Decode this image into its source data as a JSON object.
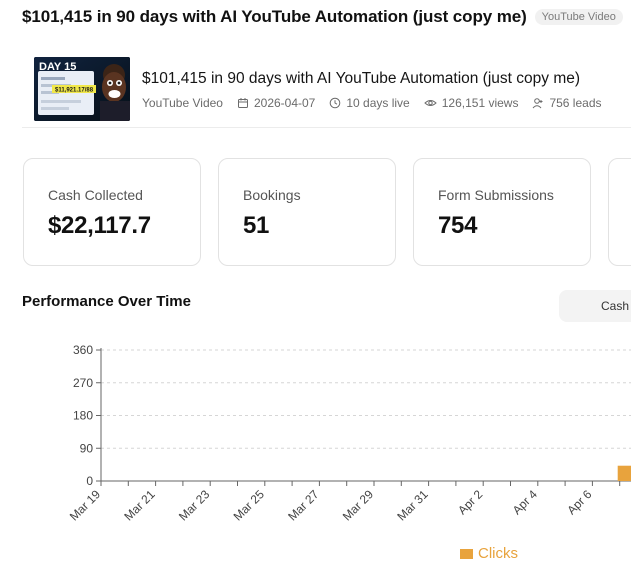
{
  "header": {
    "title": "$101,415 in 90 days with AI YouTube Automation (just copy me)",
    "badge": "YouTube Video"
  },
  "video": {
    "title": "$101,415 in 90 days with AI YouTube Automation (just copy me)",
    "type": "YouTube Video",
    "date": "2026-04-07",
    "days_live": "10 days live",
    "views": "126,151 views",
    "leads": "756 leads",
    "thumbnail": {
      "day_text": "DAY 15",
      "amount_text": "$11,921.17/88"
    }
  },
  "metrics": [
    {
      "label": "Cash Collected",
      "value": "$22,117.7"
    },
    {
      "label": "Bookings",
      "value": "51"
    },
    {
      "label": "Form Submissions",
      "value": "754"
    },
    {
      "label": "",
      "value": ""
    }
  ],
  "performance": {
    "title": "Performance Over Time",
    "metric_toggle_label": "Cash"
  },
  "chart_data": {
    "type": "bar",
    "categories": [
      "Mar 19",
      "Mar 20",
      "Mar 21",
      "Mar 22",
      "Mar 23",
      "Mar 24",
      "Mar 25",
      "Mar 26",
      "Mar 27",
      "Mar 28",
      "Mar 29",
      "Mar 30",
      "Mar 31",
      "Apr 1",
      "Apr 2",
      "Apr 3",
      "Apr 4",
      "Apr 5",
      "Apr 6",
      "Apr 7"
    ],
    "tick_labels": [
      "Mar 19",
      "Mar 21",
      "Mar 23",
      "Mar 25",
      "Mar 27",
      "Mar 29",
      "Mar 31",
      "Apr 2",
      "Apr 4",
      "Apr 6"
    ],
    "series": [
      {
        "name": "Clicks",
        "color": "#e8a33d",
        "values": [
          0,
          0,
          0,
          0,
          0,
          0,
          0,
          0,
          0,
          0,
          0,
          0,
          0,
          0,
          0,
          0,
          0,
          0,
          0,
          42
        ]
      }
    ],
    "yticks": [
      0,
      90,
      180,
      270,
      360
    ],
    "ylim": [
      0,
      360
    ],
    "grid": true,
    "legend": "bottom"
  }
}
